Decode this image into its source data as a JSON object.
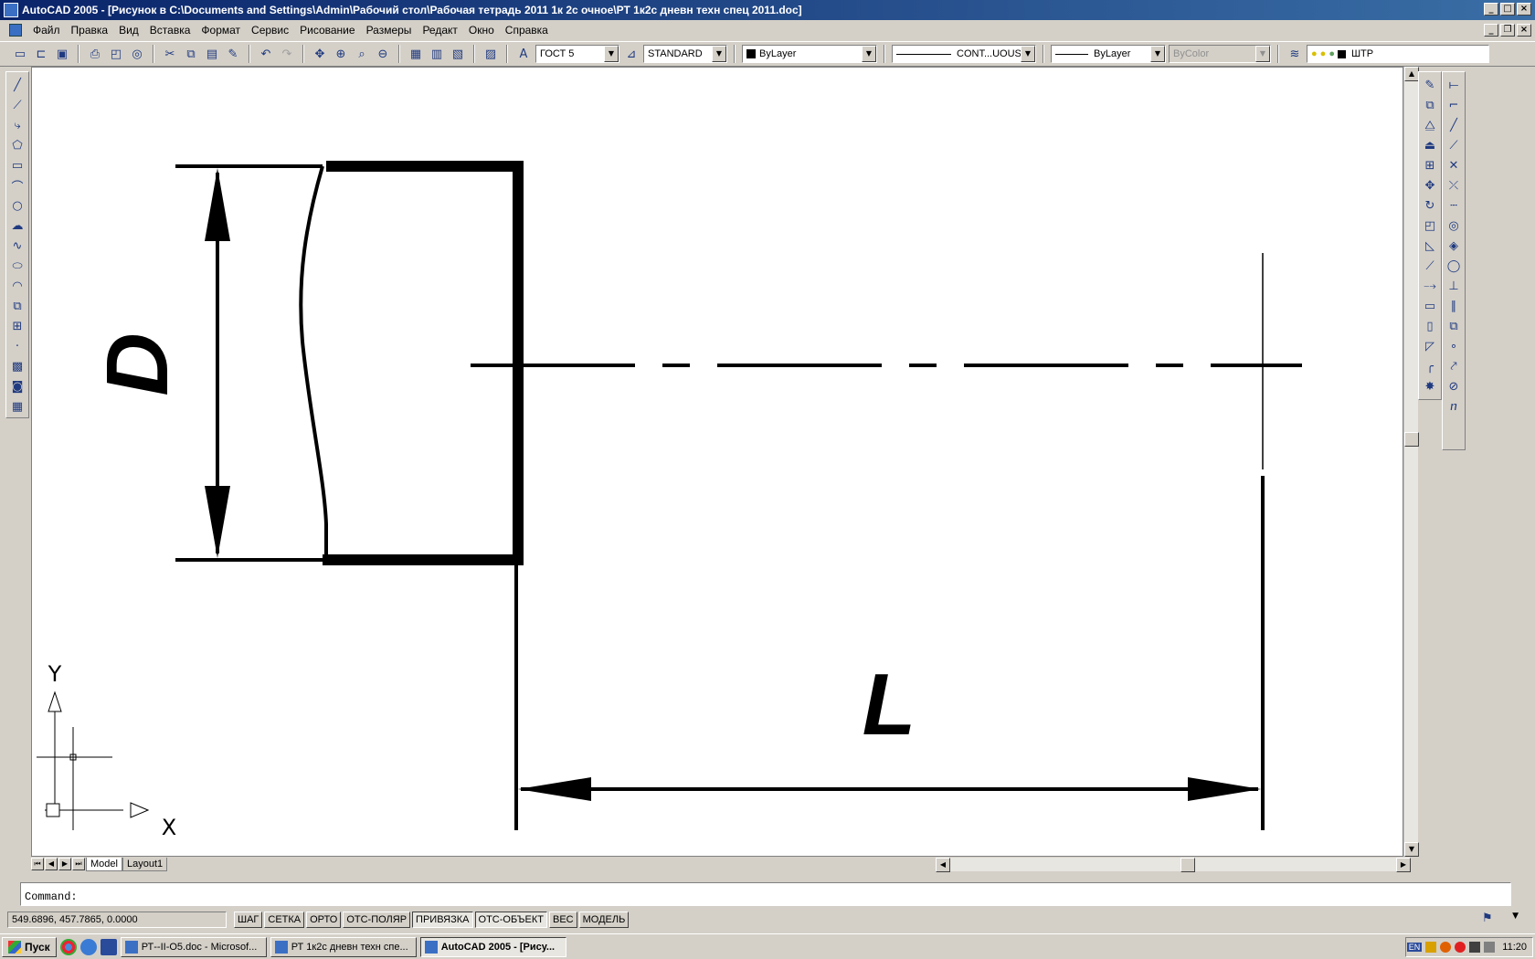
{
  "window": {
    "title": "AutoCAD 2005 - [Рисунок в C:\\Documents and Settings\\Admin\\Рабочий стол\\Рабочая тетрадь 2011 1к 2с очное\\РТ 1к2с дневн техн спец 2011.doc]"
  },
  "menu": [
    "Файл",
    "Правка",
    "Вид",
    "Вставка",
    "Формат",
    "Сервис",
    "Рисование",
    "Размеры",
    "Редакт",
    "Окно",
    "Справка"
  ],
  "toolbar": {
    "text_style": "ГОСТ 5",
    "dim_style": "STANDARD",
    "color": "ByLayer",
    "linetype": "CONT...UOUS",
    "lineweight": "ByLayer",
    "plotstyle": "ByColor",
    "layer": "ШТР"
  },
  "drawing": {
    "dim_d_label": "D",
    "dim_l_label": "L",
    "ucs_x": "X",
    "ucs_y": "Y"
  },
  "tabs": [
    "Model",
    "Layout1"
  ],
  "command": {
    "prompt": "Command:"
  },
  "status": {
    "coords": "549.6896, 457.7865, 0.0000",
    "buttons": [
      "ШАГ",
      "СЕТКА",
      "ОРТО",
      "ОТС-ПОЛЯР",
      "ПРИВЯЗКА",
      "ОТС-ОБЪЕКТ",
      "ВЕС",
      "МОДЕЛЬ"
    ]
  },
  "taskbar": {
    "start": "Пуск",
    "tasks": [
      "РТ--II-О5.doc - Microsof...",
      "РТ 1к2с дневн техн спе...",
      "AutoCAD 2005 - [Рису..."
    ],
    "language": "EN",
    "clock": "11:20"
  }
}
